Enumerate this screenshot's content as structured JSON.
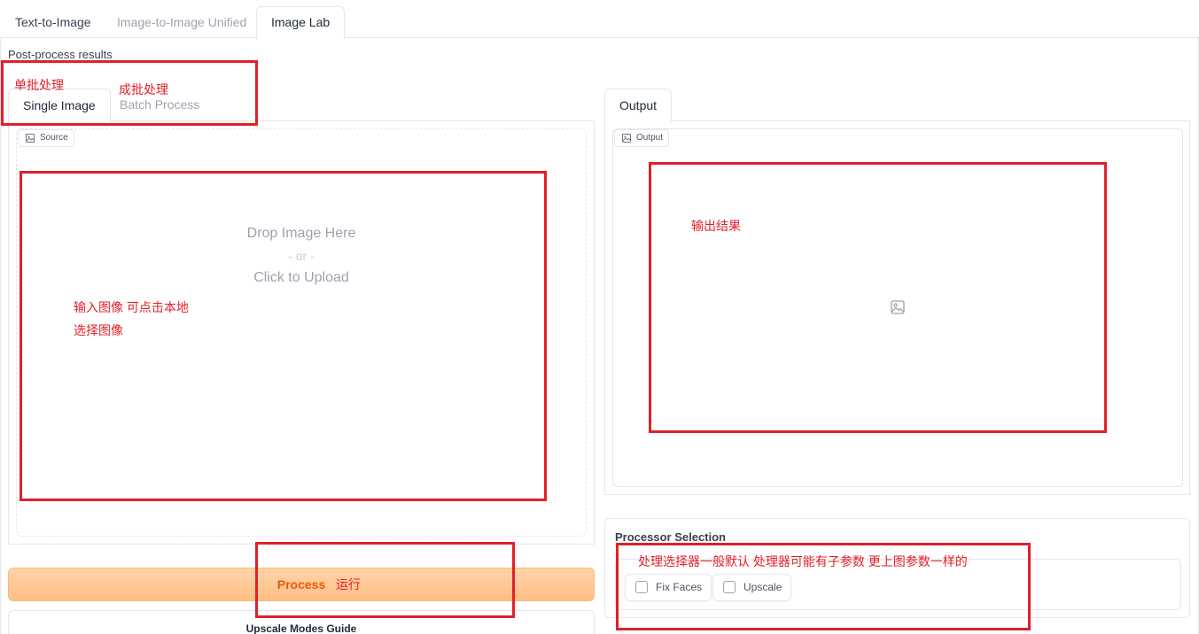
{
  "top_tabs": [
    "Text-to-Image",
    "Image-to-Image Unified",
    "Image Lab"
  ],
  "section_title": "Post-process results",
  "sub_tabs": [
    "Single Image",
    "Batch Process"
  ],
  "source": {
    "label": "Source",
    "drop_line1": "Drop Image Here",
    "drop_line2": "- or -",
    "drop_line3": "Click to Upload"
  },
  "output": {
    "tab": "Output",
    "label": "Output"
  },
  "processor": {
    "title": "Processor Selection",
    "options": [
      "Fix Faces",
      "Upscale"
    ]
  },
  "process_button": "Process",
  "guide_title": "Upscale Modes Guide",
  "annotations": {
    "single": "单批处理",
    "batch": "成批处理",
    "input_line1": "输入图像 可点击本地",
    "input_line2": "选择图像",
    "output": "输出结果",
    "run": "运行",
    "processor": "处理选择器一般默认 处理器可能有子参数 更上图参数一样的"
  },
  "colors": {
    "annotation_red": "#e0202a",
    "accent_orange": "#ea580c"
  }
}
